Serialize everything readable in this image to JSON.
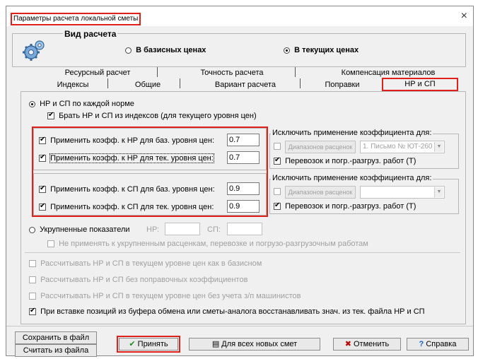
{
  "window": {
    "title": "Параметры расчета локальной сметы",
    "close_glyph": "×"
  },
  "calc_type": {
    "label": "Вид расчета",
    "option_base": "В базисных ценах",
    "option_current": "В текущих ценах",
    "selected": "current"
  },
  "tabs": {
    "row1": [
      "Ресурсный расчет",
      "Точность расчета",
      "Компенсация материалов"
    ],
    "row2": [
      "Индексы",
      "Общие",
      "Вариант расчета",
      "Поправки",
      "НР и СП"
    ],
    "active": "НР и СП"
  },
  "nr_sp": {
    "radio_norm_label": "НР и СП по каждой норме",
    "take_from_indices_label": "Брать НР и СП из индексов (для текущего уровня цен)",
    "coeffs": [
      {
        "label": "Применить коэфф. к НР для баз. уровня цен:",
        "value": "0.7",
        "checked": true
      },
      {
        "label": "Применить коэфф. к НР для тек. уровня цен:",
        "value": "0.7",
        "checked": true
      },
      {
        "label": "Применить коэфф. к СП для баз. уровня цен:",
        "value": "0.9",
        "checked": true
      },
      {
        "label": "Применить коэфф. к СП для тек. уровня цен:",
        "value": "0.9",
        "checked": true
      }
    ],
    "exclude_groups": [
      {
        "title": "Исключить применение коэффициента для:",
        "ranges_button": "Диапазонов расценок",
        "combo_value": "1. Письмо № ЮТ-260",
        "transport_label": "Перевозок и погр.-разгруз. работ (Т)"
      },
      {
        "title": "Исключить применение коэффициента для:",
        "ranges_button": "Диапазонов расценок",
        "combo_value": "",
        "transport_label": "Перевозок и погр.-разгруз. работ (Т)"
      }
    ],
    "radio_enlarged_label": "Укрупненные показатели",
    "nr_label": "НР:",
    "sp_label": "СП:",
    "nr_value": "",
    "sp_value": "",
    "no_apply_enlarged_label": "Не применять к укрупненным расценкам, перевозке и погрузо-разгрузочным работам"
  },
  "options": [
    {
      "label": "Рассчитывать НР и СП в текущем уровне цен как в базисном",
      "checked": false,
      "enabled": false
    },
    {
      "label": "Рассчитывать НР и СП без поправочных коэффициентов",
      "checked": false,
      "enabled": false
    },
    {
      "label": "Рассчитывать НР и СП в текущем уровне цен без учета з/п машинистов",
      "checked": false,
      "enabled": false
    },
    {
      "label": "При вставке позиций из буфера обмена или сметы-аналога восстанавливать знач. из тек. файла НР и СП",
      "checked": true,
      "enabled": true
    }
  ],
  "footer": {
    "save_to_file": "Сохранить в файл",
    "load_from_file": "Считать из файла",
    "accept": "Принять",
    "for_all_new": "Для всех новых смет",
    "cancel": "Отменить",
    "help": "Справка"
  },
  "colors": {
    "highlight": "#e0201a",
    "dialog_bg": "#f0f0f0",
    "accept_icon": "#1a8f1a",
    "cancel_icon": "#c00000",
    "help_icon": "#1060c0"
  }
}
